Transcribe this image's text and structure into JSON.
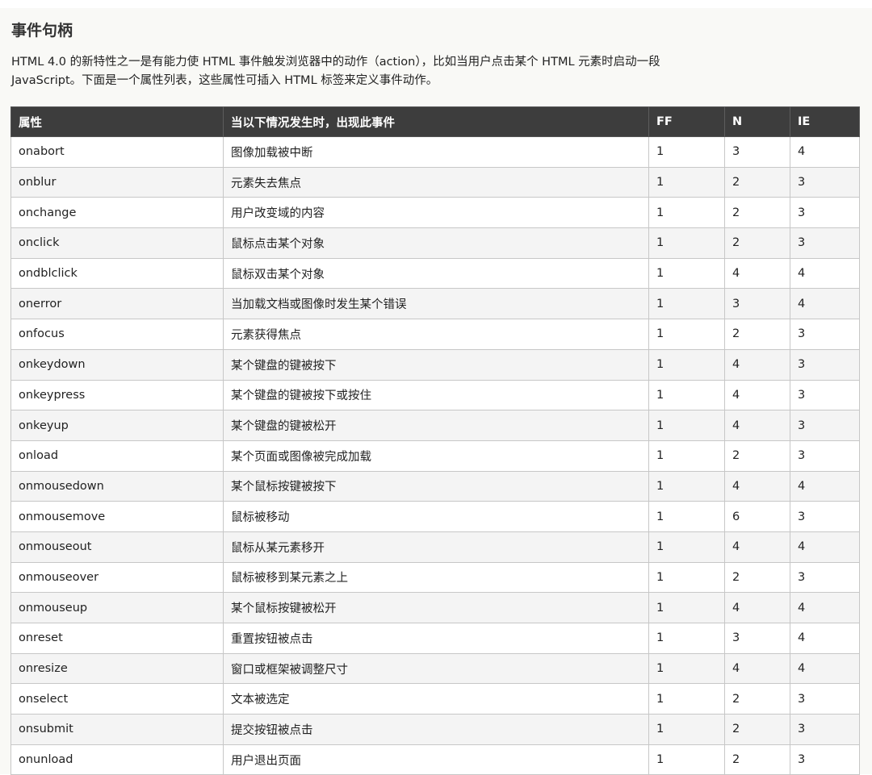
{
  "title": "事件句柄",
  "intro": "HTML 4.0 的新特性之一是有能力使 HTML 事件触发浏览器中的动作（action），比如当用户点击某个 HTML 元素时启动一段 JavaScript。下面是一个属性列表，这些属性可插入 HTML 标签来定义事件动作。",
  "table": {
    "headers": [
      "属性",
      "当以下情况发生时，出现此事件",
      "FF",
      "N",
      "IE"
    ],
    "rows": [
      [
        "onabort",
        "图像加载被中断",
        "1",
        "3",
        "4"
      ],
      [
        "onblur",
        "元素失去焦点",
        "1",
        "2",
        "3"
      ],
      [
        "onchange",
        "用户改变域的内容",
        "1",
        "2",
        "3"
      ],
      [
        "onclick",
        "鼠标点击某个对象",
        "1",
        "2",
        "3"
      ],
      [
        "ondblclick",
        "鼠标双击某个对象",
        "1",
        "4",
        "4"
      ],
      [
        "onerror",
        "当加载文档或图像时发生某个错误",
        "1",
        "3",
        "4"
      ],
      [
        "onfocus",
        "元素获得焦点",
        "1",
        "2",
        "3"
      ],
      [
        "onkeydown",
        "某个键盘的键被按下",
        "1",
        "4",
        "3"
      ],
      [
        "onkeypress",
        "某个键盘的键被按下或按住",
        "1",
        "4",
        "3"
      ],
      [
        "onkeyup",
        "某个键盘的键被松开",
        "1",
        "4",
        "3"
      ],
      [
        "onload",
        "某个页面或图像被完成加载",
        "1",
        "2",
        "3"
      ],
      [
        "onmousedown",
        "某个鼠标按键被按下",
        "1",
        "4",
        "4"
      ],
      [
        "onmousemove",
        "鼠标被移动",
        "1",
        "6",
        "3"
      ],
      [
        "onmouseout",
        "鼠标从某元素移开",
        "1",
        "4",
        "4"
      ],
      [
        "onmouseover",
        "鼠标被移到某元素之上",
        "1",
        "2",
        "3"
      ],
      [
        "onmouseup",
        "某个鼠标按键被松开",
        "1",
        "4",
        "4"
      ],
      [
        "onreset",
        "重置按钮被点击",
        "1",
        "3",
        "4"
      ],
      [
        "onresize",
        "窗口或框架被调整尺寸",
        "1",
        "4",
        "4"
      ],
      [
        "onselect",
        "文本被选定",
        "1",
        "2",
        "3"
      ],
      [
        "onsubmit",
        "提交按钮被点击",
        "1",
        "2",
        "3"
      ],
      [
        "onunload",
        "用户退出页面",
        "1",
        "2",
        "3"
      ]
    ]
  }
}
